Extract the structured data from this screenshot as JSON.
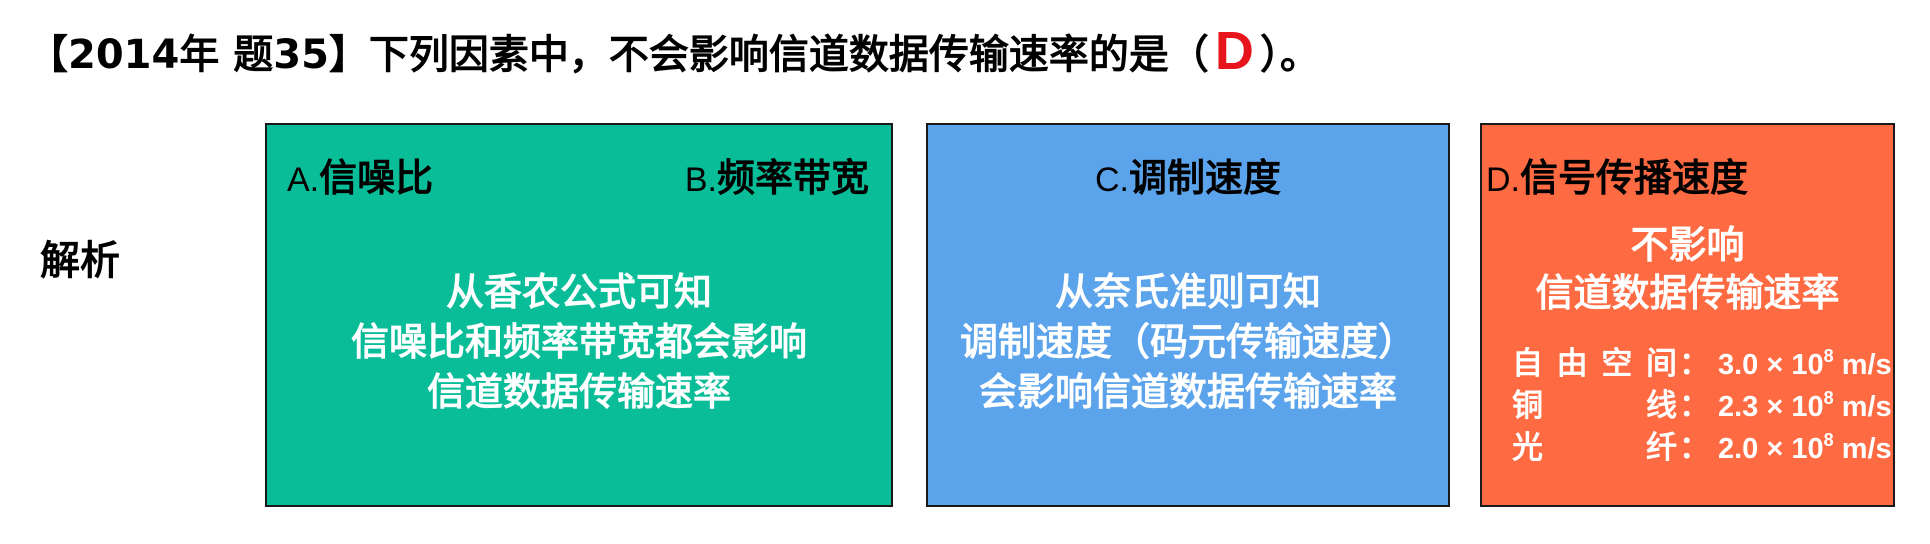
{
  "question": {
    "prefix": "【2014年 题35】下列因素中，不会影响信道数据传输速率的是（",
    "answer": "D",
    "suffix": "）。"
  },
  "analysis_label": "解析",
  "boxes": {
    "ab": {
      "optA_letter": "A.",
      "optA_text": "信噪比",
      "optB_letter": "B.",
      "optB_text": "频率带宽",
      "lines": [
        "从香农公式可知",
        "信噪比和频率带宽都会影响",
        "信道数据传输速率"
      ],
      "color": "#08bd98"
    },
    "c": {
      "optC_letter": "C.",
      "optC_text": "调制速度",
      "lines": [
        "从奈氏准则可知",
        "调制速度（码元传输速度）",
        "会影响信道数据传输速率"
      ],
      "color": "#5ba3ea"
    },
    "d": {
      "optD_letter": "D.",
      "optD_text": "信号传播速度",
      "lines": [
        "不影响",
        "信道数据传输速率"
      ],
      "speeds": [
        {
          "medium_chars": [
            "自",
            "由",
            "空",
            "间"
          ],
          "value": "3.0 × 10",
          "exp": "8",
          "unit": " m/s"
        },
        {
          "medium_chars": [
            "铜",
            "线"
          ],
          "value": "2.3 × 10",
          "exp": "8",
          "unit": " m/s"
        },
        {
          "medium_chars": [
            "光",
            "纤"
          ],
          "value": "2.0 × 10",
          "exp": "8",
          "unit": " m/s"
        }
      ],
      "colon": "：",
      "color": "#fe6a42"
    }
  }
}
